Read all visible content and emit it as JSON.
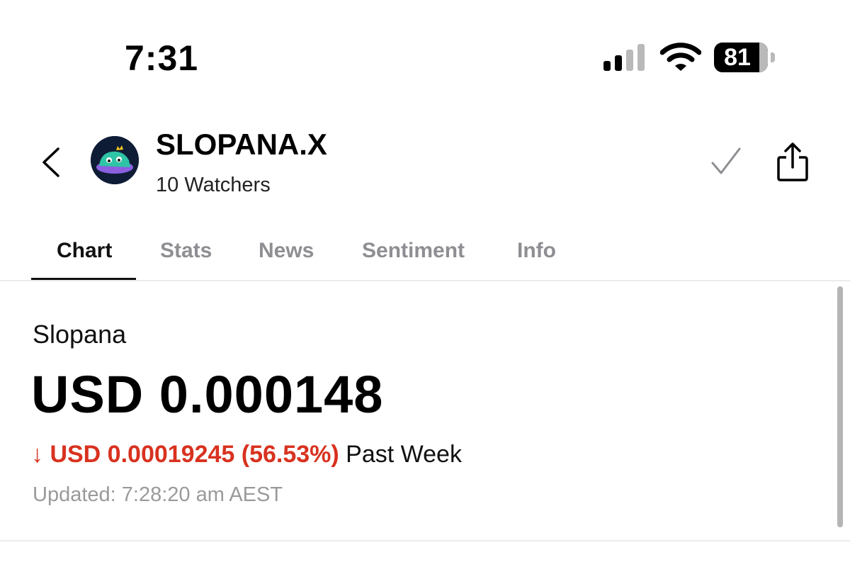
{
  "status_bar": {
    "time": "7:31",
    "battery_level": "81"
  },
  "header": {
    "ticker": "SLOPANA.X",
    "watchers": "10 Watchers",
    "icons": [
      "back-chevron",
      "token-avatar",
      "checkmark",
      "share"
    ]
  },
  "tabs": [
    {
      "label": "Chart",
      "active": true
    },
    {
      "label": "Stats",
      "active": false
    },
    {
      "label": "News",
      "active": false
    },
    {
      "label": "Sentiment",
      "active": false
    },
    {
      "label": "Info",
      "active": false
    }
  ],
  "quote": {
    "name": "Slopana",
    "price": "USD 0.000148",
    "change_arrow": "↓",
    "change": "USD 0.00019245 (56.53%)",
    "period": "Past Week",
    "updated": "Updated: 7:28:20 am AEST"
  },
  "colors": {
    "negative": "#d8321f",
    "inactive_tab": "#8e8e93",
    "muted_text": "#9a9a9a"
  }
}
